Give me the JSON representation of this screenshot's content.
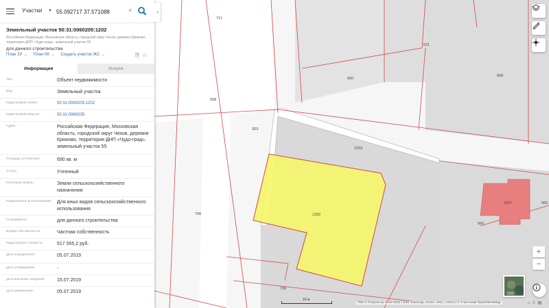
{
  "search": {
    "type_label": "Участки",
    "value": "55.092717 37.571088"
  },
  "parcel": {
    "title": "Земельный участок 50:31:0060205:1202",
    "address": "Российская Федерация, Московская область, городской округ Чехов, деревня Крюково, территория ДНП «Чудо-град», земельный участок 55",
    "use": "для дачного строительства",
    "links": [
      "План ЗУ →",
      "План КК →",
      "Создать участок ЖС →"
    ]
  },
  "tabs": [
    {
      "label": "Информация",
      "active": true
    },
    {
      "label": "Услуги",
      "active": false
    }
  ],
  "rows": [
    {
      "label": "Тип:",
      "value": "Объект недвижимости"
    },
    {
      "label": "Вид:",
      "value": "Земельный участок"
    },
    {
      "label": "Кадастровый номер:",
      "value": "50:31:0060205:1202",
      "link": true
    },
    {
      "label": "Кадастровый квартал:",
      "value": "50:31:0060205",
      "link": true
    },
    {
      "label": "Адрес:",
      "value": "Российская Федерация, Московская область, городской округ Чехов, деревня Крюково, территория ДНП «Чудо-град», земельный участок 55"
    },
    {
      "label": "Площадь уточненная:",
      "value": "690 кв. м"
    },
    {
      "label": "Статус:",
      "value": "Учтенный"
    },
    {
      "label": "Категория земель:",
      "value": "Земли сельскохозяйственного назначения"
    },
    {
      "label": "Разрешенное использование:",
      "value": "Для иных видов сельскохозяйственного использования"
    },
    {
      "label": "по документу:",
      "value": "для дачного строительства"
    },
    {
      "label": "Форма собственности:",
      "value": "Частная собственность"
    },
    {
      "label": "Кадастровая стоимость:",
      "value": "517 555,2 руб."
    },
    {
      "label": "дата определения:",
      "value": "05.07.2019"
    },
    {
      "label": "дата утверждения:",
      "value": "-"
    },
    {
      "label": "дата внесения сведений:",
      "value": "15.07.2019"
    },
    {
      "label": "дата применения:",
      "value": "05.07.2019"
    }
  ],
  "map": {
    "parcel_labels": [
      "711",
      "621",
      "600",
      "606",
      "698",
      "303",
      "1203",
      "1202",
      "1057",
      "560",
      "560",
      "706",
      "730"
    ],
    "scale_label": "10 м",
    "attribution": "ПКК © Росреестр 2010-2021 | Esri, Intermap, NASA, NGA, USGS | © Участники OpenStreetMap"
  },
  "colors": {
    "selected_parcel": "#f5f56a",
    "boundary": "#d64545",
    "highlight_building": "#e77f7f",
    "link": "#2b6cb0"
  },
  "icons": {
    "menu": "hamburger-icon",
    "search": "search-icon",
    "layers": "layers-icon",
    "ruler": "ruler-icon",
    "locate": "locate-icon",
    "zoom_in": "plus-icon",
    "zoom_out": "minus-icon",
    "info": "info-icon"
  }
}
